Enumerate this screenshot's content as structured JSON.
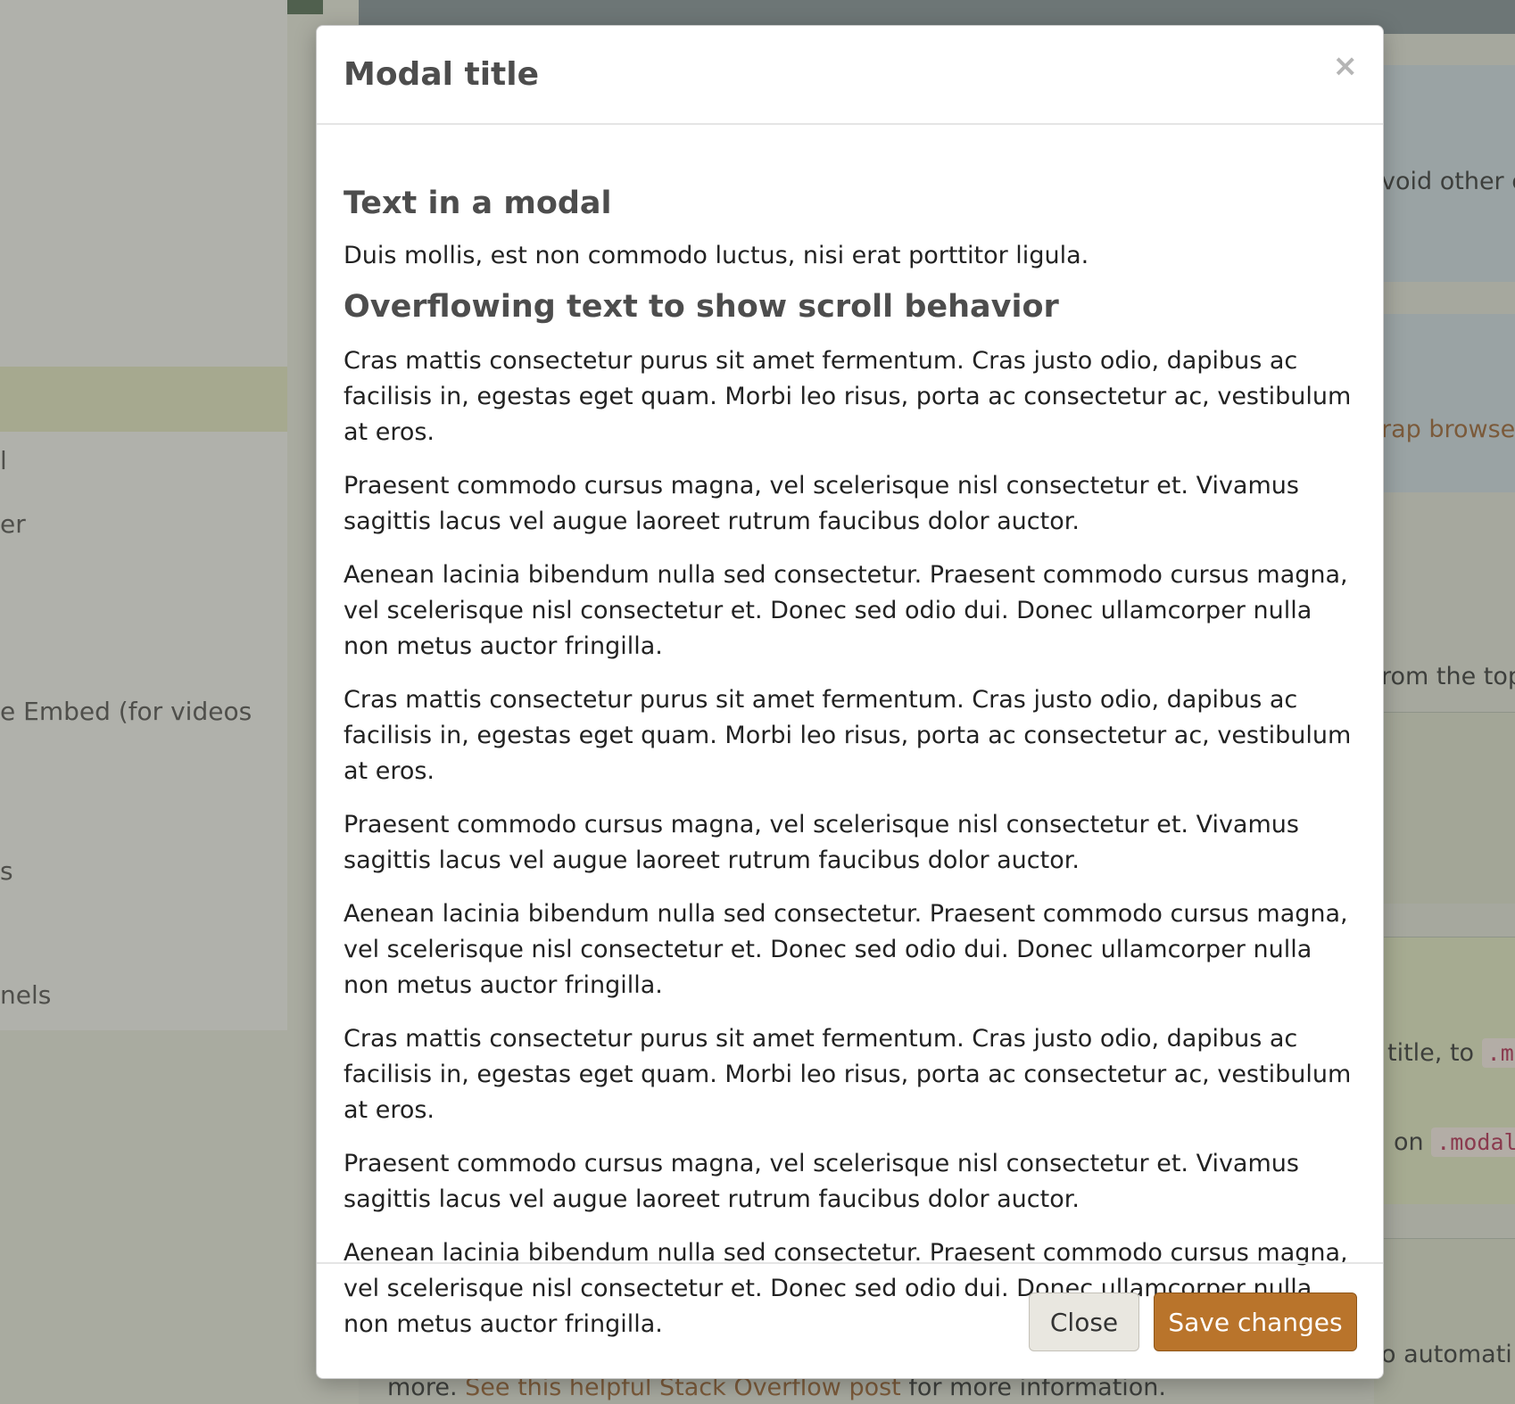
{
  "background": {
    "sidebar_items": [
      "l",
      "er",
      "e Embed (for videos",
      "s",
      "nels"
    ],
    "right_snippets": {
      "avoid": "void other c",
      "browser_link": "rap browse",
      "from_top": "rom the top",
      "title_to": "title, to",
      "title_to_code": ".mo",
      "on": "on",
      "on_code": ".modal",
      "automati": "o automati",
      "more_prefix": "more.",
      "more_link": "See this helpful Stack Overflow post",
      "more_suffix": "for more information."
    }
  },
  "modal": {
    "title": "Modal title",
    "close_glyph": "×",
    "body": {
      "heading1": "Text in a modal",
      "intro": "Duis mollis, est non commodo luctus, nisi erat porttitor ligula.",
      "heading2": "Overflowing text to show scroll behavior",
      "paragraphs": [
        "Cras mattis consectetur purus sit amet fermentum. Cras justo odio, dapibus ac facilisis in, egestas eget quam. Morbi leo risus, porta ac consectetur ac, vestibulum at eros.",
        "Praesent commodo cursus magna, vel scelerisque nisl consectetur et. Vivamus sagittis lacus vel augue laoreet rutrum faucibus dolor auctor.",
        "Aenean lacinia bibendum nulla sed consectetur. Praesent commodo cursus magna, vel scelerisque nisl consectetur et. Donec sed odio dui. Donec ullamcorper nulla non metus auctor fringilla.",
        "Cras mattis consectetur purus sit amet fermentum. Cras justo odio, dapibus ac facilisis in, egestas eget quam. Morbi leo risus, porta ac consectetur ac, vestibulum at eros.",
        "Praesent commodo cursus magna, vel scelerisque nisl consectetur et. Vivamus sagittis lacus vel augue laoreet rutrum faucibus dolor auctor.",
        "Aenean lacinia bibendum nulla sed consectetur. Praesent commodo cursus magna, vel scelerisque nisl consectetur et. Donec sed odio dui. Donec ullamcorper nulla non metus auctor fringilla.",
        "Cras mattis consectetur purus sit amet fermentum. Cras justo odio, dapibus ac facilisis in, egestas eget quam. Morbi leo risus, porta ac consectetur ac, vestibulum at eros.",
        "Praesent commodo cursus magna, vel scelerisque nisl consectetur et. Vivamus sagittis lacus vel augue laoreet rutrum faucibus dolor auctor.",
        "Aenean lacinia bibendum nulla sed consectetur. Praesent commodo cursus magna, vel scelerisque nisl consectetur et. Donec sed odio dui. Donec ullamcorper nulla non metus auctor fringilla."
      ]
    },
    "footer": {
      "close_label": "Close",
      "save_label": "Save changes"
    }
  },
  "colors": {
    "primary": "#b9742b",
    "backdrop": "#a9aba0"
  }
}
